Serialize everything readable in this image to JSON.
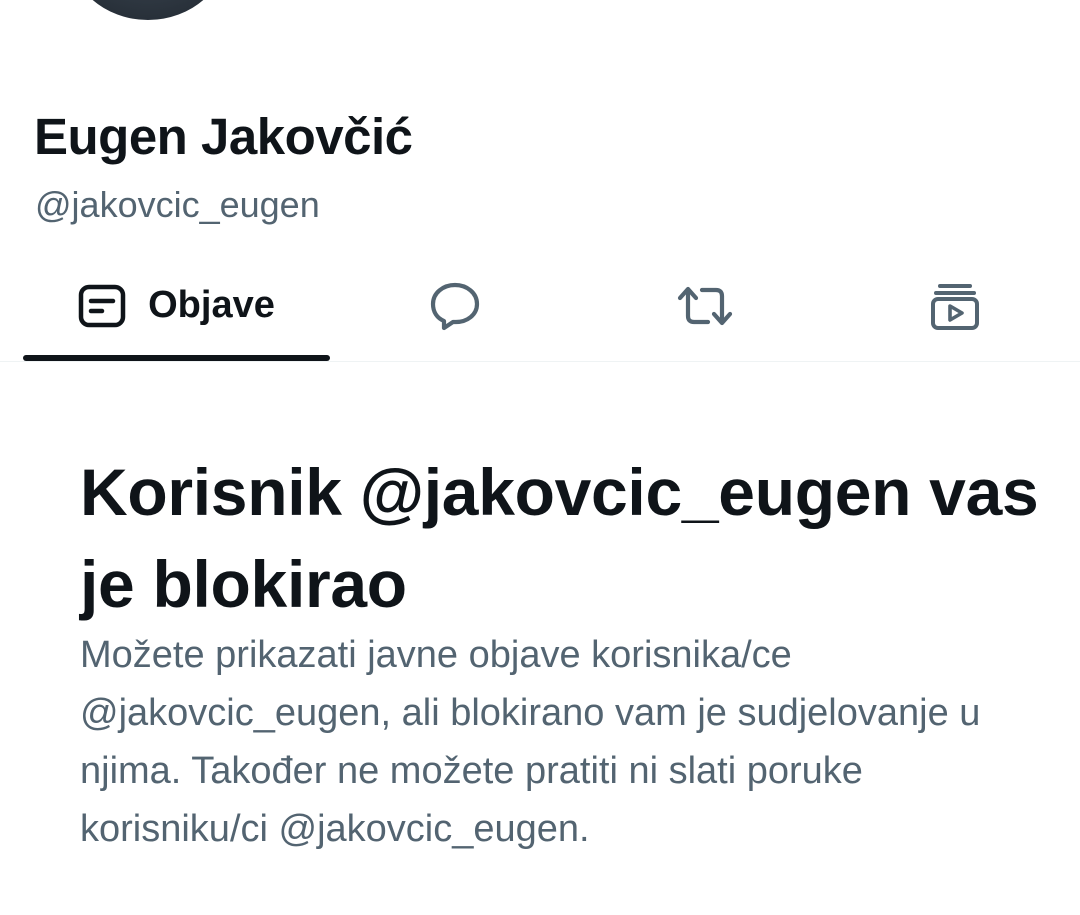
{
  "profile": {
    "display_name": "Eugen Jakovčić",
    "handle": "@jakovcic_eugen"
  },
  "tabs": [
    {
      "label": "Objave",
      "icon": "posts-icon",
      "active": true
    },
    {
      "label": "",
      "icon": "replies-icon",
      "active": false
    },
    {
      "label": "",
      "icon": "reposts-icon",
      "active": false
    },
    {
      "label": "",
      "icon": "media-icon",
      "active": false
    }
  ],
  "blocked": {
    "title": "Korisnik @jakovcic_eugen vas je blokirao",
    "description": "Možete prikazati javne objave korisnika/ce @jakovcic_eugen, ali blokirano vam je sudjelovanje u njima. Također ne možete pratiti ni slati poruke korisniku/ci @jakovcic_eugen."
  },
  "colors": {
    "primary_text": "#0f1419",
    "secondary_text": "#536471",
    "divider": "#eff3f4"
  }
}
